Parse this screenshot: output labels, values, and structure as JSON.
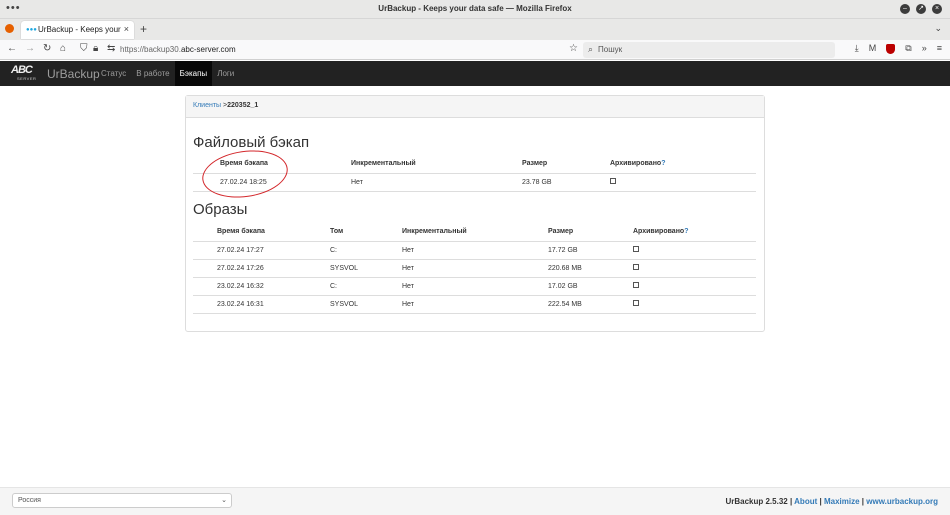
{
  "window": {
    "title": "UrBackup - Keeps your data safe — Mozilla Firefox"
  },
  "browser": {
    "tab_title": "UrBackup - Keeps your data safe",
    "url_prefix": "https://backup30.",
    "url_domain": "abc-server.com",
    "search_placeholder": "Пошук"
  },
  "app": {
    "logo_text": "ABC",
    "logo_sub": "SERVER",
    "brand": "UrBackup",
    "menu": [
      "Статус",
      "В работе",
      "Бэкапы",
      "Логи"
    ],
    "active_menu": "Бэкапы"
  },
  "breadcrumb": {
    "link": "Клиенты",
    "separator": ">",
    "current": "220352_1"
  },
  "file_backups": {
    "heading": "Файловый бэкап",
    "headers": [
      "Время бэкапа",
      "Инкрементальный",
      "Размер",
      "Архивировано",
      "?"
    ],
    "rows": [
      {
        "time": "27.02.24 18:25",
        "incremental": "Нет",
        "size": "23.78 GB",
        "archived": false
      }
    ]
  },
  "image_backups": {
    "heading": "Образы",
    "headers": [
      "Время бэкапа",
      "Том",
      "Инкрементальный",
      "Размер",
      "Архивировано",
      "?"
    ],
    "rows": [
      {
        "time": "27.02.24 17:27",
        "volume": "C:",
        "incremental": "Нет",
        "size": "17.72 GB",
        "archived": false
      },
      {
        "time": "27.02.24 17:26",
        "volume": "SYSVOL",
        "incremental": "Нет",
        "size": "220.68 MB",
        "archived": false
      },
      {
        "time": "23.02.24 16:32",
        "volume": "C:",
        "incremental": "Нет",
        "size": "17.02 GB",
        "archived": false
      },
      {
        "time": "23.02.24 16:31",
        "volume": "SYSVOL",
        "incremental": "Нет",
        "size": "222.54 MB",
        "archived": false
      }
    ]
  },
  "footer": {
    "language": "Россия",
    "version": "UrBackup 2.5.32",
    "sep": "|",
    "about": "About",
    "maximize": "Maximize",
    "site": "www.urbackup.org"
  },
  "colors": {
    "link": "#337ab7",
    "annotation_circle": "#d3262a",
    "header_bg": "#222222"
  }
}
